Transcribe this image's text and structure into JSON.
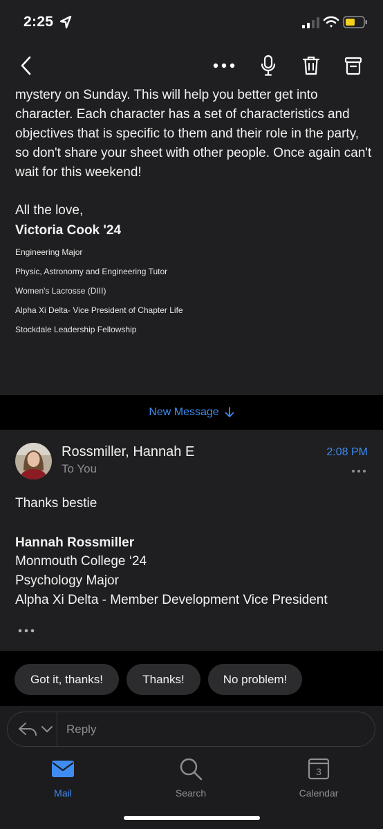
{
  "status_bar": {
    "time": "2:25",
    "icons": [
      "location-arrow-icon",
      "cellular-signal-icon",
      "wifi-icon",
      "battery-icon"
    ],
    "battery_color": "#f5d01e"
  },
  "toolbar": {
    "icons": [
      "chevron-left-icon",
      "more-horizontal-icon",
      "microphone-icon",
      "trash-icon",
      "archive-icon"
    ]
  },
  "previous_message": {
    "body_lines": [
      "mystery on Sunday. This will help you better get into",
      "character. Each character has a set of characteristics and",
      "objectives that is specific to them and their role in the party,",
      "so don't share your sheet with other people. Once again can't",
      "wait for this weekend!"
    ],
    "signoff": "All the love,",
    "signature_name": "Victoria Cook '24",
    "signature_lines": [
      "Engineering Major",
      "Physic, Astronomy and Engineering Tutor",
      "Women's Lacrosse (DIII)",
      "Alpha Xi Delta- Vice President of Chapter Life",
      "Stockdale Leadership Fellowship"
    ]
  },
  "new_message_bar": {
    "label": "New Message"
  },
  "message": {
    "sender": "Rossmiller, Hannah E",
    "recipient": "To You",
    "time": "2:08 PM",
    "body": "Thanks bestie",
    "signature_name": "Hannah Rossmiller",
    "signature_lines": [
      "Monmouth College ‘24",
      "Psychology Major",
      "Alpha Xi Delta - Member Development Vice President"
    ]
  },
  "quick_replies": [
    "Got it, thanks!",
    "Thanks!",
    "No problem!"
  ],
  "reply_bar": {
    "label": "Reply"
  },
  "tab_bar": {
    "tabs": [
      {
        "label": "Mail",
        "icon": "mail-icon",
        "active": true
      },
      {
        "label": "Search",
        "icon": "search-icon",
        "active": false
      },
      {
        "label": "Calendar",
        "icon": "calendar-icon",
        "active": false,
        "day": "3"
      }
    ]
  },
  "colors": {
    "accent": "#3f8cf0",
    "surface": "#1f1f21",
    "background": "#000000",
    "chip": "#2c2c2e"
  }
}
